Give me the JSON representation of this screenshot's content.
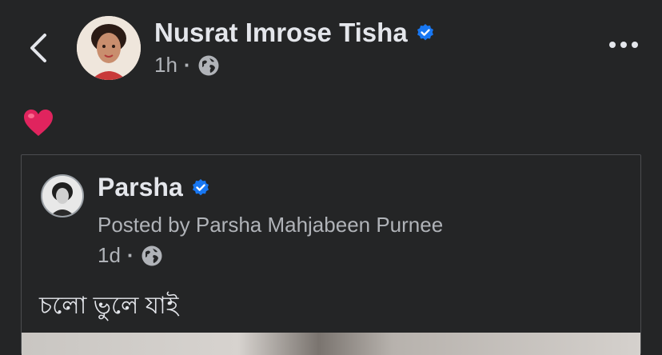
{
  "header": {
    "back_icon": "chevron-left-icon",
    "author_name": "Nusrat Imrose Tisha",
    "time": "1h",
    "separator": "·",
    "audience_icon": "globe-icon",
    "more_icon": "more-horizontal-icon",
    "verified_icon": "verified-badge-icon"
  },
  "post": {
    "reaction_emoji": "❤️"
  },
  "shared_post": {
    "page_name": "Parsha",
    "posted_by": "Posted by Parsha Mahjabeen Purnee",
    "time": "1d",
    "separator": "·",
    "text": "চলো ভুলে যাই"
  },
  "colors": {
    "background": "#242526",
    "primary_text": "#e4e6eb",
    "secondary_text": "#b0b3b8",
    "verified_blue": "#1877f2",
    "heart_red": "#e0245e"
  }
}
